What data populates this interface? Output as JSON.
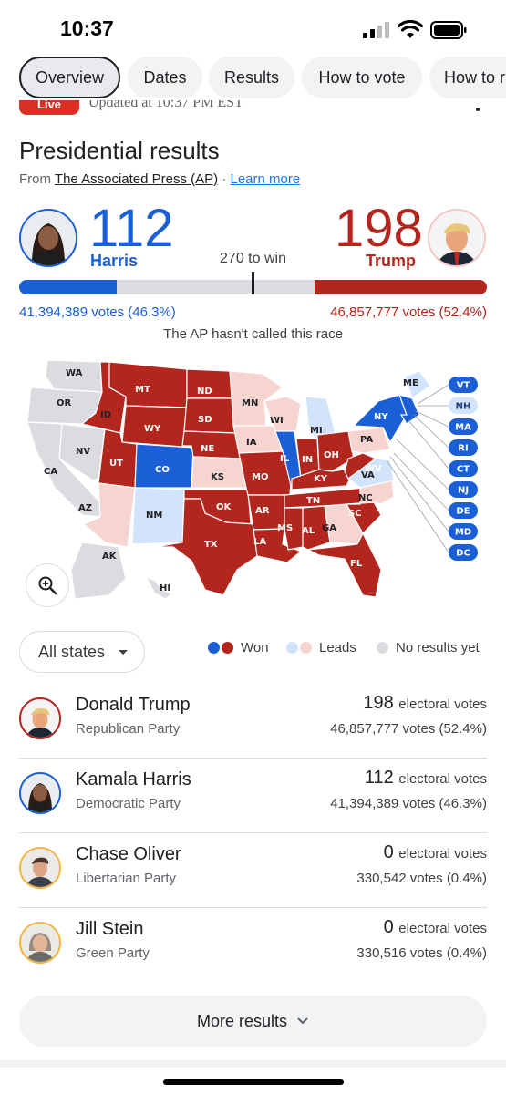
{
  "status_bar": {
    "time": "10:37"
  },
  "tabs": [
    {
      "label": "Overview",
      "active": true
    },
    {
      "label": "Dates"
    },
    {
      "label": "Results"
    },
    {
      "label": "How to vote"
    },
    {
      "label": "How to r"
    }
  ],
  "live": {
    "badge": "Live",
    "updated": "Updated at 10:37 PM EST"
  },
  "header": {
    "title": "Presidential results",
    "source_prefix": "From ",
    "source_link": "The Associated Press (AP)",
    "separator": " · ",
    "learn_more": "Learn more"
  },
  "race": {
    "harris": {
      "name": "Harris",
      "electoral": "112",
      "votes": "41,394,389 votes (46.3%)",
      "ev_fraction": 0.2082
    },
    "trump": {
      "name": "Trump",
      "electoral": "198",
      "votes": "46,857,777 votes (52.4%)",
      "ev_fraction": 0.368
    },
    "to_win": "270 to win",
    "status": "The AP hasn't called this race"
  },
  "colors": {
    "dem_won": "#1a5fd6",
    "rep_won": "#b3261e",
    "dem_leads": "#d2e3fc",
    "rep_leads": "#f6d5d1",
    "no_results": "#dadce0"
  },
  "map": {
    "states": {
      "WA": "none",
      "OR": "none",
      "CA": "none",
      "NV": "none",
      "ID": "rep_won",
      "MT": "rep_won",
      "WY": "rep_won",
      "UT": "rep_won",
      "CO": "dem_won",
      "AZ": "rep_leads",
      "NM": "dem_leads",
      "ND": "rep_won",
      "SD": "rep_won",
      "NE": "rep_won",
      "KS": "rep_leads",
      "OK": "rep_won",
      "TX": "rep_won",
      "MN": "rep_leads",
      "IA": "rep_leads",
      "MO": "rep_won",
      "AR": "rep_won",
      "LA": "rep_won",
      "WI": "rep_leads",
      "IL": "dem_won",
      "MI": "dem_leads",
      "IN": "rep_won",
      "OH": "rep_won",
      "KY": "rep_won",
      "TN": "rep_won",
      "MS": "rep_won",
      "AL": "rep_won",
      "GA": "rep_leads",
      "FL": "rep_won",
      "SC": "rep_won",
      "NC": "rep_leads",
      "VA": "dem_leads",
      "WV": "rep_won",
      "PA": "rep_leads",
      "NY": "dem_won",
      "ME": "dem_leads",
      "AK": "none",
      "HI": "none"
    },
    "side_states": [
      {
        "abbr": "VT",
        "status": "dem_won"
      },
      {
        "abbr": "NH",
        "status": "dem_leads"
      },
      {
        "abbr": "MA",
        "status": "dem_won"
      },
      {
        "abbr": "RI",
        "status": "dem_won"
      },
      {
        "abbr": "CT",
        "status": "dem_won"
      },
      {
        "abbr": "NJ",
        "status": "dem_won"
      },
      {
        "abbr": "DE",
        "status": "dem_won"
      },
      {
        "abbr": "MD",
        "status": "dem_won"
      },
      {
        "abbr": "DC",
        "status": "dem_won"
      }
    ],
    "zoom_icon": "zoom-in-icon"
  },
  "filter": {
    "label": "All states"
  },
  "legend": {
    "won": "Won",
    "leads": "Leads",
    "none": "No results yet"
  },
  "candidates": [
    {
      "name": "Donald Trump",
      "party": "Republican Party",
      "electoral": "198",
      "electoral_label": "electoral votes",
      "votes": "46,857,777 votes (52.4%)",
      "ring": "#b3261e"
    },
    {
      "name": "Kamala Harris",
      "party": "Democratic Party",
      "electoral": "112",
      "electoral_label": "electoral votes",
      "votes": "41,394,389 votes (46.3%)",
      "ring": "#1a5fd6"
    },
    {
      "name": "Chase Oliver",
      "party": "Libertarian Party",
      "electoral": "0",
      "electoral_label": "electoral votes",
      "votes": "330,542 votes (0.4%)",
      "ring": "#f2b441"
    },
    {
      "name": "Jill Stein",
      "party": "Green Party",
      "electoral": "0",
      "electoral_label": "electoral votes",
      "votes": "330,516 votes (0.4%)",
      "ring": "#f2b441"
    }
  ],
  "more_results": "More results"
}
